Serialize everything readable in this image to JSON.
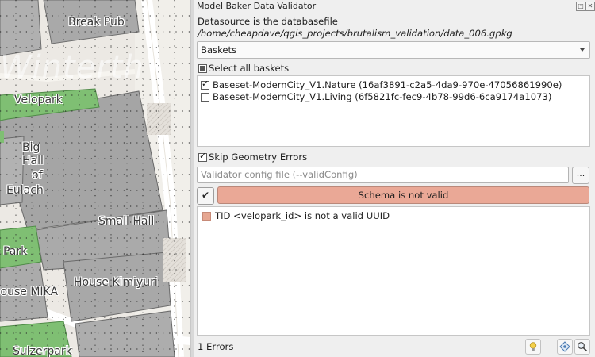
{
  "map": {
    "watermark": "Winterth",
    "labels": [
      "Break Pub",
      "Velopark",
      "Big",
      "Hall",
      "of",
      "Eulach",
      "Small Hall",
      "t Park",
      "House MIKA",
      "House Kimiyuri",
      "Sulzerpark"
    ]
  },
  "dock": {
    "title": "Model Baker Data Validator",
    "datasource_prefix": "Datasource is the databasefile ",
    "datasource_path": "/home/cheapdave/qgis_projects/brutalism_validation/data_006.gpkg",
    "combo_value": "Baskets",
    "select_all_label": "Select all baskets",
    "baskets": [
      {
        "label": "Baseset-ModernCity_V1.Nature (16af3891-c2a5-4da9-970e-47056861990e)",
        "checked": true
      },
      {
        "label": "Baseset-ModernCity_V1.Living (6f5821fc-fec9-4b78-99d6-6ca9174a1073)",
        "checked": false
      }
    ],
    "skip_label": "Skip Geometry Errors",
    "config_placeholder": "Validator config file (--validConfig)",
    "browse_label": "...",
    "run_label": "✔",
    "result_text": "Schema is not valid",
    "result_color": "#eaa896",
    "errors": [
      {
        "text": "TID <velopark_id> is not a valid UUID",
        "color": "#e6a792"
      }
    ],
    "status_text": "1 Errors"
  }
}
